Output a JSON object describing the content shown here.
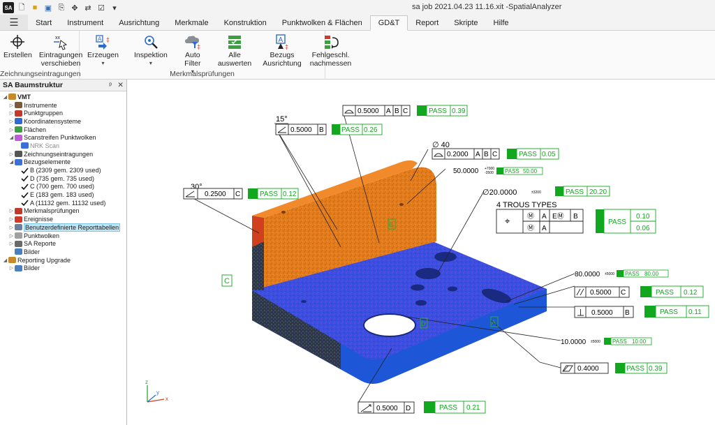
{
  "app": {
    "title": "sa job 2021.04.23 11.16.xit -SpatialAnalyzer",
    "qat_icons": [
      "sa-logo-icon",
      "new-file-icon",
      "open-folder-icon",
      "save-icon",
      "save-dropdown-icon",
      "move-icon",
      "coordinate-icon",
      "toggle-icon",
      "customize-icon"
    ]
  },
  "tabs": [
    {
      "label": "Start",
      "active": false
    },
    {
      "label": "Instrument",
      "active": false
    },
    {
      "label": "Ausrichtung",
      "active": false
    },
    {
      "label": "Merkmale",
      "active": false
    },
    {
      "label": "Konstruktion",
      "active": false
    },
    {
      "label": "Punktwolken & Flächen",
      "active": false
    },
    {
      "label": "GD&T",
      "active": true
    },
    {
      "label": "Report",
      "active": false
    },
    {
      "label": "Skripte",
      "active": false
    },
    {
      "label": "Hilfe",
      "active": false
    }
  ],
  "ribbon": {
    "group1": {
      "label": "Zeichnungseintragungen",
      "buttons": [
        {
          "line1": "Erstellen",
          "line2": ""
        },
        {
          "line1": "Eintragungen",
          "line2": "verschieben"
        }
      ]
    },
    "group2": {
      "label": "Merkmalsprüfungen",
      "buttons": [
        {
          "line1": "Erzeugen",
          "line2": "▾"
        },
        {
          "line1": "Inspektion",
          "line2": "▾"
        },
        {
          "line1": "Auto Filter",
          "line2": "▾"
        },
        {
          "line1": "Alle",
          "line2": "auswerten"
        },
        {
          "line1": "Bezugs",
          "line2": "Ausrichtung"
        },
        {
          "line1": "Fehlgeschl.",
          "line2": "nachmessen"
        }
      ]
    }
  },
  "panel": {
    "title": "SA Baumstruktur",
    "pin": "ᵖ",
    "close": "✕",
    "nodes": [
      {
        "label": "VMT",
        "indent": 0,
        "toggle": "◢",
        "icon": "#c58a2a",
        "bold": true
      },
      {
        "label": "Instrumente",
        "indent": 1,
        "toggle": "▷",
        "icon": "#7a5a3a"
      },
      {
        "label": "Punktgruppen",
        "indent": 1,
        "toggle": "▷",
        "icon": "#c0392b"
      },
      {
        "label": "Koordinatensysteme",
        "indent": 1,
        "toggle": "▷",
        "icon": "#2c6bd1"
      },
      {
        "label": "Flächen",
        "indent": 1,
        "toggle": "▷",
        "icon": "#3aa040"
      },
      {
        "label": "Scanstreifen Punktwolken",
        "indent": 1,
        "toggle": "◢",
        "icon": "#c25bd9"
      },
      {
        "label": "NRK Scan",
        "indent": 2,
        "toggle": "",
        "icon": "#3c6fd8",
        "grey": true
      },
      {
        "label": "Zeichnungseintragungen",
        "indent": 1,
        "toggle": "▷",
        "icon": "#555555"
      },
      {
        "label": "Bezugselemente",
        "indent": 1,
        "toggle": "◢",
        "icon": "#3c6fd8"
      },
      {
        "label": "B (2309 gem. 2309 used)",
        "indent": 2,
        "toggle": "",
        "icon": "check"
      },
      {
        "label": "D (735 gem. 735 used)",
        "indent": 2,
        "toggle": "",
        "icon": "check"
      },
      {
        "label": "C (700 gem. 700 used)",
        "indent": 2,
        "toggle": "",
        "icon": "check"
      },
      {
        "label": "E (183 gem. 183 used)",
        "indent": 2,
        "toggle": "",
        "icon": "check"
      },
      {
        "label": "A (11132 gem. 11132 used)",
        "indent": 2,
        "toggle": "",
        "icon": "check"
      },
      {
        "label": "Merkmalsprüfungen",
        "indent": 1,
        "toggle": "▷",
        "icon": "#c0392b"
      },
      {
        "label": "Ereignisse",
        "indent": 1,
        "toggle": "▷",
        "icon": "#d03a2a"
      },
      {
        "label": "Benutzerdefinierte Reporttabellen",
        "indent": 1,
        "toggle": "▷",
        "icon": "#6a7fa0",
        "selected": true
      },
      {
        "label": "Punktwolken",
        "indent": 1,
        "toggle": "▷",
        "icon": "#a0a0a0"
      },
      {
        "label": "SA Reporte",
        "indent": 1,
        "toggle": "▷",
        "icon": "#6a6a6a"
      },
      {
        "label": "Bilder",
        "indent": 1,
        "toggle": "",
        "icon": "#4a7fc0"
      },
      {
        "label": "Reporting Upgrade",
        "indent": 0,
        "toggle": "◢",
        "icon": "#c58a2a"
      },
      {
        "label": "Bilder",
        "indent": 1,
        "toggle": "▷",
        "icon": "#4a7fc0"
      }
    ]
  },
  "viewport": {
    "callouts": {
      "c1": {
        "value": "0.5000",
        "datums": [
          "A",
          "B",
          "C"
        ],
        "status": "PASS",
        "result": "0.39"
      },
      "c2": {
        "angle": "15°",
        "value": "0.5000",
        "datums": [
          "B"
        ],
        "status": "PASS",
        "result": "0.26"
      },
      "c3": {
        "diameter": "∅ 40",
        "value": "0.2000",
        "datums": [
          "A",
          "B",
          "C"
        ],
        "status": "PASS",
        "result": "0.05"
      },
      "c4": {
        "value": "50.0000",
        "tol_top": "+7000",
        "tol_bot": "-3500",
        "status": "PASS",
        "result": "50.00"
      },
      "c5": {
        "angle": "30°",
        "value": "0.2500",
        "datums": [
          "C"
        ],
        "status": "PASS",
        "result": "0.12"
      },
      "c6": {
        "value": "∅20.0000",
        "tol": "±3200",
        "status": "PASS",
        "result": "20.20"
      },
      "c7": {
        "title": "4 TROUS TYPES",
        "row1": [
          "⌖",
          "Ⓜ",
          "A",
          "EⓂ",
          "B"
        ],
        "row2": [
          "Ⓜ",
          "A"
        ],
        "status": "PASS",
        "result1": "0.10",
        "result2": "0.06"
      },
      "c8": {
        "value": "80.0000",
        "tol": "±5000",
        "status": "PASS",
        "result": "80.00"
      },
      "c9": {
        "value": "0.5000",
        "datums": [
          "C"
        ],
        "status": "PASS",
        "result": "0.12"
      },
      "c10": {
        "value": "0.5000",
        "datums": [
          "B"
        ],
        "status": "PASS",
        "result": "0.11"
      },
      "c11": {
        "value": "10.0000",
        "tol": "±5000",
        "status": "PASS",
        "result": "10.00"
      },
      "c12": {
        "value": "0.4000",
        "status": "PASS",
        "result": "0.39"
      },
      "c13": {
        "value": "0.5000",
        "datums": [
          "D"
        ],
        "status": "PASS",
        "result": "0.21"
      }
    },
    "datum_labels": {
      "c": "C",
      "a": "A",
      "b": "B",
      "d": "D"
    },
    "axis": {
      "x": "x",
      "y": "y",
      "z": "z"
    },
    "colors": {
      "pass": "#11a81f",
      "text_green": "#11a81f",
      "part_orange": "#e27c1d",
      "part_blue": "#2f5de0",
      "part_red": "#d0401f"
    }
  }
}
